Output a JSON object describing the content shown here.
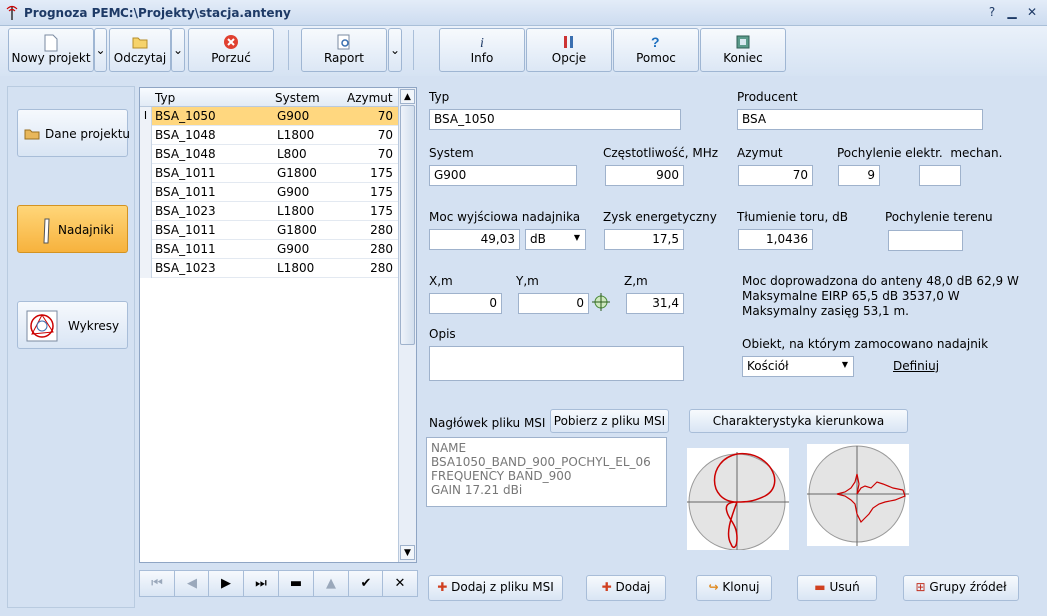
{
  "window": {
    "app_name": "Prognoza PEM",
    "file_path": "C:\\Projekty\\stacja.anteny"
  },
  "toolbar": {
    "new_project": "Nowy projekt",
    "open": "Odczytaj",
    "discard": "Porzuć",
    "report": "Raport",
    "info": "Info",
    "options": "Opcje",
    "help": "Pomoc",
    "exit": "Koniec"
  },
  "nav": {
    "project_data": "Dane projektu",
    "transmitters": "Nadajniki",
    "charts": "Wykresy"
  },
  "grid": {
    "columns": [
      "Typ",
      "System",
      "Azymut"
    ],
    "rows": [
      {
        "typ": "BSA_1050",
        "system": "G900",
        "azymut": "70"
      },
      {
        "typ": "BSA_1048",
        "system": "L1800",
        "azymut": "70"
      },
      {
        "typ": "BSA_1048",
        "system": "L800",
        "azymut": "70"
      },
      {
        "typ": "BSA_1011",
        "system": "G1800",
        "azymut": "175"
      },
      {
        "typ": "BSA_1011",
        "system": "G900",
        "azymut": "175"
      },
      {
        "typ": "BSA_1023",
        "system": "L1800",
        "azymut": "175"
      },
      {
        "typ": "BSA_1011",
        "system": "G1800",
        "azymut": "280"
      },
      {
        "typ": "BSA_1011",
        "system": "G900",
        "azymut": "280"
      },
      {
        "typ": "BSA_1023",
        "system": "L1800",
        "azymut": "280"
      }
    ],
    "row_indicator": "I"
  },
  "form": {
    "typ_label": "Typ",
    "typ_value": "BSA_1050",
    "producer_label": "Producent",
    "producer_value": "BSA",
    "system_label": "System",
    "system_value": "G900",
    "freq_label": "Częstotliwość, MHz",
    "freq_value": "900",
    "azimuth_label": "Azymut",
    "azimuth_value": "70",
    "tilt_label": "Pochylenie elektr.  mechan.",
    "tilt_el_value": "9",
    "tilt_mech_value": "",
    "power_label": "Moc wyjściowa nadajnika",
    "power_value": "49,03",
    "power_unit": "dB",
    "gain_label": "Zysk energetyczny",
    "gain_value": "17,5",
    "loss_label": "Tłumienie toru, dB",
    "loss_value": "1,0436",
    "terrain_label": "Pochylenie terenu",
    "terrain_value": "",
    "x_label": "X,m",
    "x_value": "0",
    "y_label": "Y,m",
    "y_value": "0",
    "z_label": "Z,m",
    "z_value": "31,4",
    "desc_label": "Opis",
    "desc_value": "",
    "info_line1": "Moc doprowadzona do anteny 48,0 dB  62,9 W",
    "info_line2": "Maksymalne EIRP 65,5 dB  3537,0 W",
    "info_line3": "Maksymalny zasięg 53,1 m.",
    "object_label": "Obiekt, na którym zamocowano nadajnik",
    "object_value": "Kościół",
    "define_link": "Definiuj",
    "msi_label": "Nagłówek pliku MSI",
    "msi_button": "Pobierz z pliku MSI",
    "pattern_button": "Charakterystyka kierunkowa",
    "msi_lines": [
      "NAME",
      "BSA1050_BAND_900_POCHYL_EL_06",
      "FREQUENCY BAND_900",
      "GAIN 17.21 dBi"
    ]
  },
  "bottom": {
    "add_msi": "Dodaj z pliku MSI",
    "add": "Dodaj",
    "clone": "Klonuj",
    "delete": "Usuń",
    "groups": "Grupy źródeł"
  },
  "colors": {
    "selected_row": "#ffd77f",
    "active_nav": "#f7b23d",
    "pattern_line": "#cc0000"
  }
}
